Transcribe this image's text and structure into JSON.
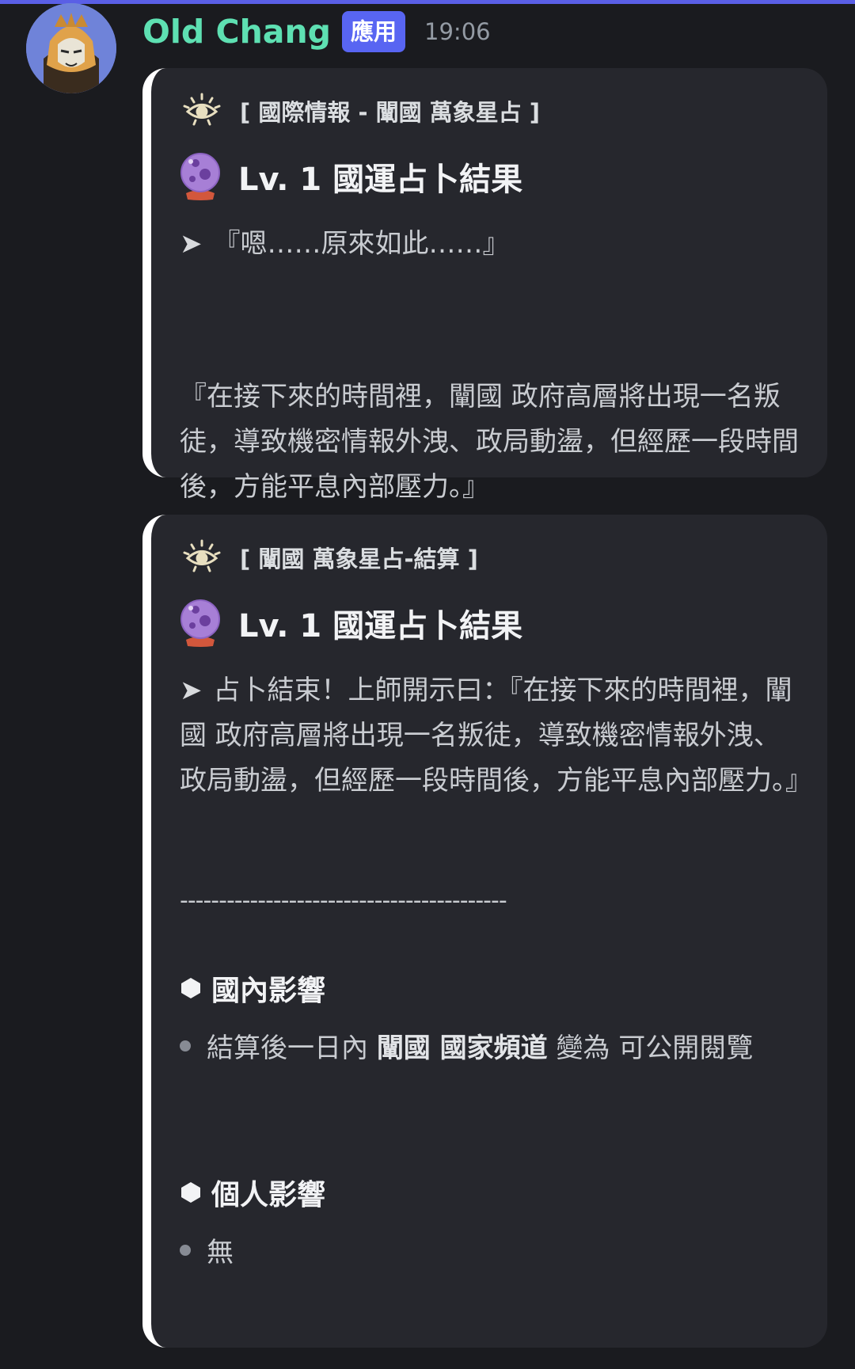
{
  "message": {
    "username": "Old Chang",
    "badge": "應用",
    "timestamp": "19:06"
  },
  "embeds": [
    {
      "author": "[ 國際情報 - 闡國 萬象星占 ]",
      "title": "Lv. 1 國運占卜結果",
      "arrow": "➤",
      "line1": "『嗯……原來如此……』",
      "paragraph": "『在接下來的時間裡，闡國 政府高層將出現一名叛徒，導致機密情報外洩、政局動盪，但經歷一段時間後，方能平息內部壓力。』"
    },
    {
      "author": "[ 闡國 萬象星占-結算 ]",
      "title": "Lv. 1 國運占卜結果",
      "arrow": "➤",
      "description": "占卜結束！上師開示曰：『在接下來的時間裡，闡國 政府高層將出現一名叛徒，導致機密情報外洩、政局動盪，但經歷一段時間後，方能平息內部壓力。』",
      "divider": "------------------------------------------",
      "sections": [
        {
          "heading": "國內影響",
          "bullet_pre": "結算後一日內 ",
          "bullet_bold": "闡國 國家頻道",
          "bullet_post": " 變為 可公開閱覽"
        },
        {
          "heading": "個人影響",
          "bullet_text": "無"
        }
      ]
    }
  ],
  "icons": {
    "author_icon": "eye-icon",
    "title_icon": "crystal-ball-icon",
    "section_icon": "hexagon-icon",
    "bullet_icon": "bullet-dot-icon"
  },
  "colors": {
    "background": "#1a1b1f",
    "embed_background": "#26272d",
    "embed_border": "#ffffff",
    "username": "#5ee0b2",
    "badge": "#5865f2",
    "accent_bar": "#5a5fe6"
  }
}
